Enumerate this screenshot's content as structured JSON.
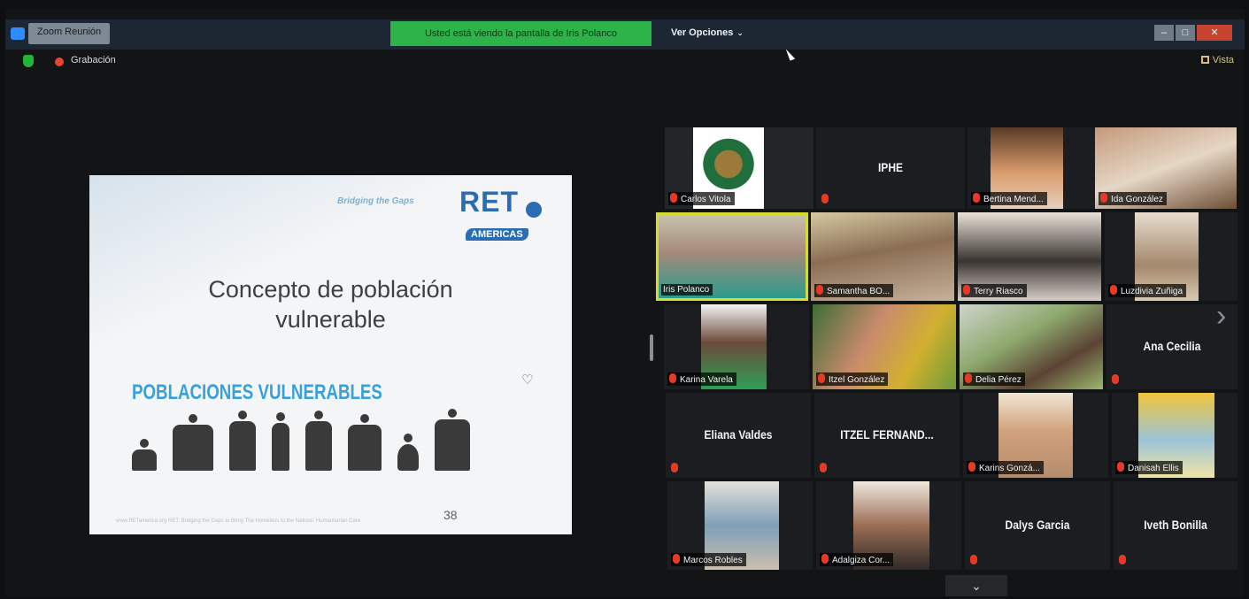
{
  "titlebar": {
    "app_title": "Zoom Reunión",
    "share_banner": "Usted está viendo la pantalla de Iris Polanco",
    "view_options": "Ver Opciones",
    "view_options_chevron": "⌄",
    "minimize": "–",
    "maximize": "□",
    "close": "✕"
  },
  "recording": {
    "label": "Grabación",
    "view_label": "Vista"
  },
  "slide": {
    "tagline": "Bridging the Gaps",
    "brand_main": "RET",
    "brand_sub": "AMERICAS",
    "title_line1": "Concepto de población",
    "title_line2": "vulnerable",
    "section_title": "POBLACIONES VULNERABLES",
    "footer": "www.RETamerica.org   RET, Bridging the Gaps to Bring The Homeless to the Nations' Humanitarian Care",
    "page_number": "38"
  },
  "participants": [
    {
      "name": "Carlos Vitola",
      "kind": "photo"
    },
    {
      "name": "IPHE",
      "kind": "name"
    },
    {
      "name": "Bertina Mend...",
      "kind": "photo"
    },
    {
      "name": "Ida González",
      "kind": "photo"
    },
    {
      "name": "Iris Polanco",
      "kind": "photo",
      "active": true
    },
    {
      "name": "Samantha BO...",
      "kind": "photo"
    },
    {
      "name": "Terry Riasco",
      "kind": "photo"
    },
    {
      "name": "Luzdivia Zuñiga",
      "kind": "photo"
    },
    {
      "name": "Karina Varela",
      "kind": "photo"
    },
    {
      "name": "Itzel González",
      "kind": "photo"
    },
    {
      "name": "Delia Pérez",
      "kind": "photo"
    },
    {
      "name": "Ana Cecilia",
      "kind": "name"
    },
    {
      "name": "Eliana Valdes",
      "kind": "name"
    },
    {
      "name": "ITZEL FERNAND...",
      "kind": "name"
    },
    {
      "name": "Karins Gonzá...",
      "kind": "photo"
    },
    {
      "name": "Danisah Ellis",
      "kind": "photo"
    },
    {
      "name": "Marcos Robles",
      "kind": "photo"
    },
    {
      "name": "Adalgiza Cor...",
      "kind": "photo"
    },
    {
      "name": "Dalys Garcia",
      "kind": "name"
    },
    {
      "name": "Iveth Bonilla",
      "kind": "name"
    }
  ],
  "nav": {
    "next_page": "›",
    "collapse": "⌄"
  },
  "colors": {
    "share_banner": "#2eb24a",
    "active_speaker": "#d6dc2b",
    "muted": "#e53a25",
    "brand": "#2b6db4"
  }
}
